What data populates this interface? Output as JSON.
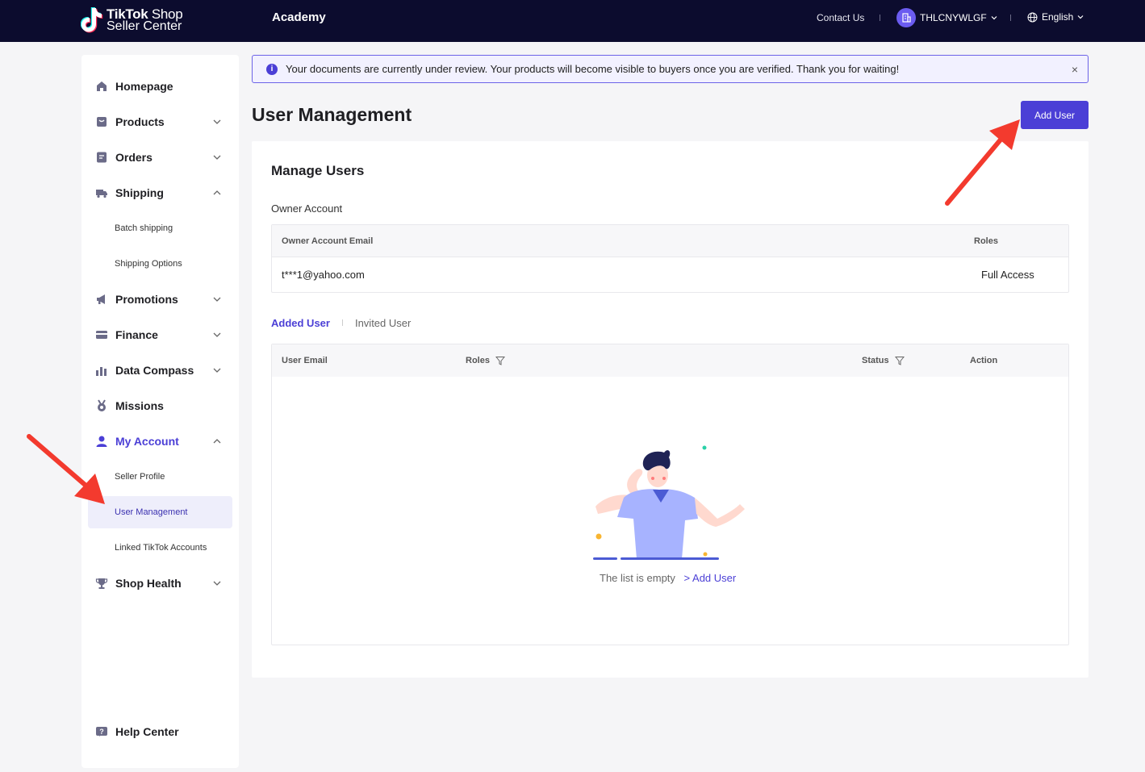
{
  "header": {
    "logo_line1_bold": "TikTok",
    "logo_line1_thin": "Shop",
    "logo_line2": "Seller Center",
    "academy": "Academy",
    "contact": "Contact Us",
    "account_name": "THLCNYWLGF",
    "language": "English"
  },
  "sidebar": {
    "items": [
      {
        "label": "Homepage",
        "icon": "home-icon"
      },
      {
        "label": "Products",
        "icon": "products-icon"
      },
      {
        "label": "Orders",
        "icon": "orders-icon"
      },
      {
        "label": "Shipping",
        "icon": "truck-icon"
      },
      {
        "label": "Batch shipping"
      },
      {
        "label": "Shipping Options"
      },
      {
        "label": "Promotions",
        "icon": "megaphone-icon"
      },
      {
        "label": "Finance",
        "icon": "card-icon"
      },
      {
        "label": "Data Compass",
        "icon": "chart-icon"
      },
      {
        "label": "Missions",
        "icon": "medal-icon"
      },
      {
        "label": "My Account",
        "icon": "user-icon"
      },
      {
        "label": "Seller Profile"
      },
      {
        "label": "User Management"
      },
      {
        "label": "Linked TikTok Accounts"
      },
      {
        "label": "Shop Health",
        "icon": "trophy-icon"
      },
      {
        "label": "Help Center",
        "icon": "help-icon"
      }
    ]
  },
  "banner": {
    "text": "Your documents are currently under review. Your products will become visible to buyers once you are verified. Thank you for waiting!",
    "close": "×"
  },
  "page": {
    "title": "User Management",
    "add_user": "Add User"
  },
  "card": {
    "title": "Manage Users",
    "owner_section": "Owner Account",
    "owner_columns": [
      "Owner Account Email",
      "Roles"
    ],
    "owner_row": {
      "email": "t***1@yahoo.com",
      "role": "Full Access"
    },
    "tabs": [
      "Added User",
      "Invited User"
    ],
    "user_columns": [
      "User Email",
      "Roles",
      "Status",
      "Action"
    ],
    "empty_text": "The list is empty",
    "empty_link": "> Add User"
  },
  "colors": {
    "accent": "#4b3fd6",
    "topbar": "#0c0c2e",
    "annotation_arrow": "#f33a2e"
  }
}
